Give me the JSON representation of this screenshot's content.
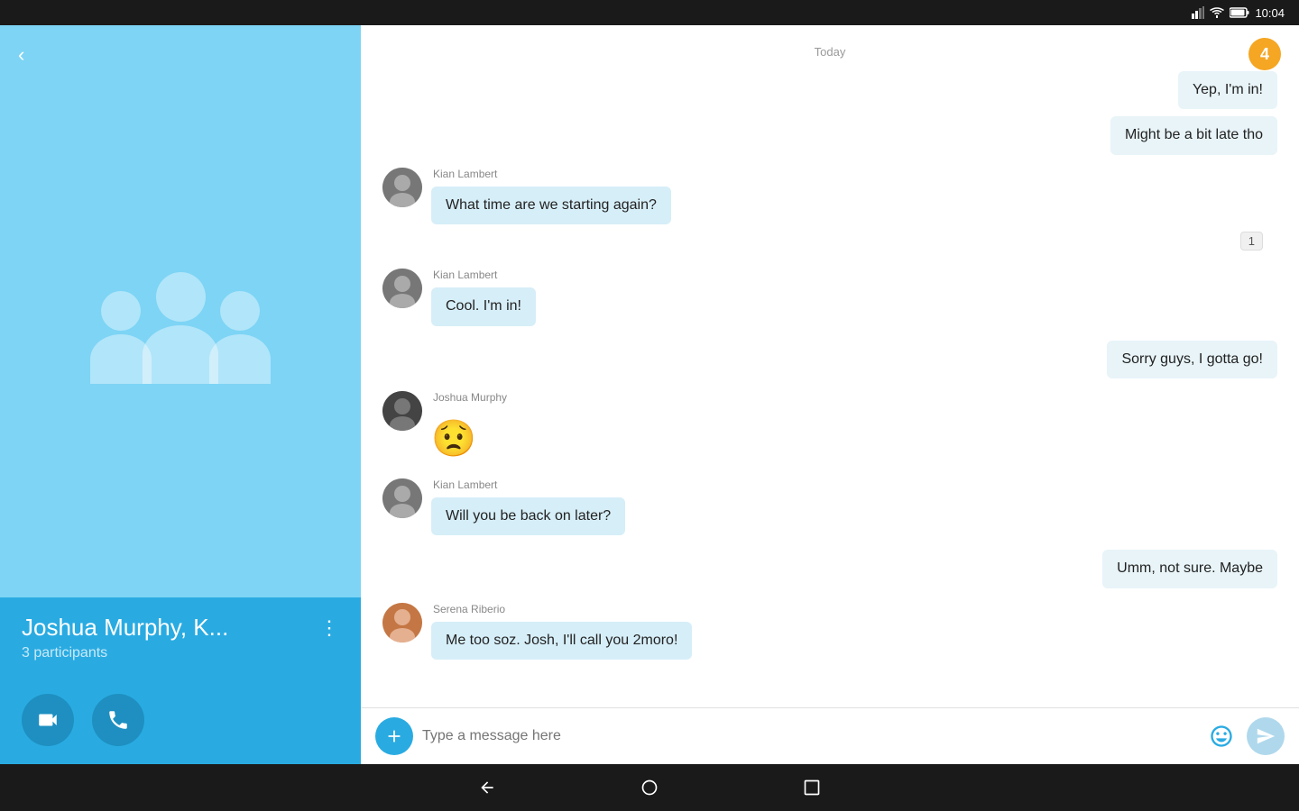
{
  "statusBar": {
    "time": "10:04"
  },
  "sidebar": {
    "backLabel": "‹",
    "groupName": "Joshua Murphy, K...",
    "participantsLabel": "3 participants",
    "moreDots": "⋮",
    "notificationCount": "4"
  },
  "messages": {
    "dateDivider": "Today",
    "items": [
      {
        "id": 1,
        "type": "outgoing",
        "text": "Yep, I'm in!",
        "sender": "self",
        "senderName": ""
      },
      {
        "id": 2,
        "type": "outgoing",
        "text": "Might be a bit late tho",
        "sender": "self",
        "senderName": ""
      },
      {
        "id": 3,
        "type": "incoming",
        "text": "What time are we starting again?",
        "sender": "kian",
        "senderName": "Kian Lambert"
      },
      {
        "id": 4,
        "type": "outgoing-reaction",
        "text": "",
        "reaction": "1"
      },
      {
        "id": 5,
        "type": "incoming",
        "text": "Cool. I'm in!",
        "sender": "kian",
        "senderName": "Kian Lambert"
      },
      {
        "id": 6,
        "type": "outgoing",
        "text": "Sorry guys, I gotta go!",
        "sender": "self",
        "senderName": ""
      },
      {
        "id": 7,
        "type": "incoming-emoji",
        "text": "😟",
        "sender": "joshua",
        "senderName": "Joshua Murphy"
      },
      {
        "id": 8,
        "type": "incoming",
        "text": "Will you be back on later?",
        "sender": "kian",
        "senderName": "Kian Lambert"
      },
      {
        "id": 9,
        "type": "outgoing",
        "text": "Umm, not sure. Maybe",
        "sender": "self",
        "senderName": ""
      },
      {
        "id": 10,
        "type": "incoming",
        "text": "Me too soz. Josh, I'll call you 2moro!",
        "sender": "serena",
        "senderName": "Serena Riberio"
      }
    ]
  },
  "input": {
    "placeholder": "Type a message here"
  },
  "actions": {
    "video": "video-camera",
    "call": "phone"
  }
}
